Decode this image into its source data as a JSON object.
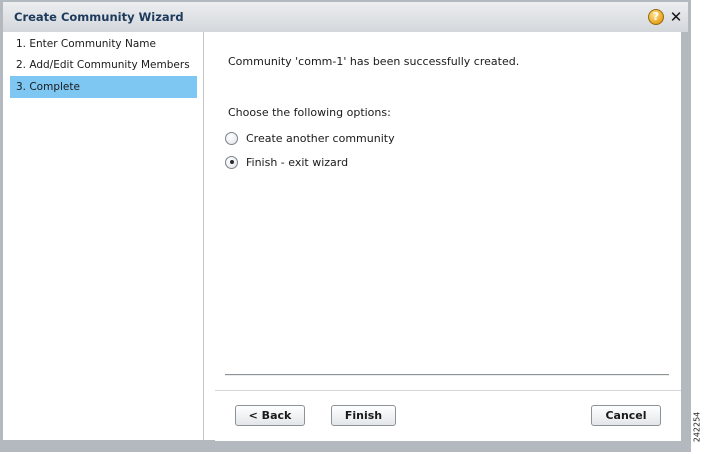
{
  "dialog": {
    "title": "Create Community Wizard",
    "help_glyph": "?",
    "close_glyph": "✕",
    "icons": {
      "help": "help-icon",
      "close": "close-icon"
    }
  },
  "steps": [
    {
      "label": "1. Enter Community Name",
      "active": false
    },
    {
      "label": "2. Add/Edit Community Members",
      "active": false
    },
    {
      "label": "3. Complete",
      "active": true
    }
  ],
  "main": {
    "message": "Community 'comm-1' has been successfully created.",
    "prompt": "Choose the following options:",
    "options": [
      {
        "label": "Create another community",
        "selected": false
      },
      {
        "label": "Finish - exit wizard",
        "selected": true
      }
    ]
  },
  "footer": {
    "back_label": "< Back",
    "finish_label": "Finish",
    "cancel_label": "Cancel"
  },
  "figure_id": "242254",
  "colors": {
    "active_step": "#7ec7f2",
    "title_text": "#1d3a5c",
    "frame": "#b4b9bf"
  }
}
